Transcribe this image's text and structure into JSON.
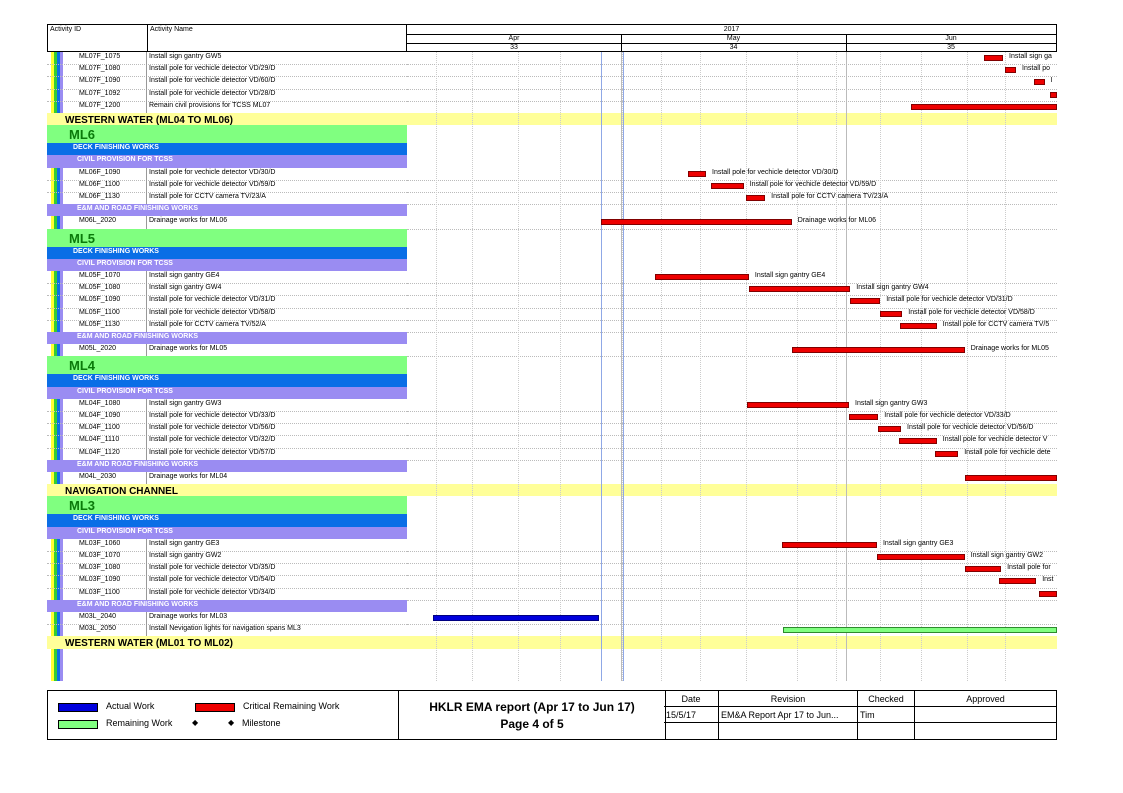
{
  "header": {
    "col_activity_id": "Activity ID",
    "col_activity_name": "Activity Name",
    "year": "2017",
    "months": [
      "Apr",
      "May",
      "Jun"
    ],
    "weeks": [
      "33",
      "34",
      "35"
    ]
  },
  "rows": [
    {
      "kind": "act",
      "id": "ML07F_1075",
      "name": "Install sign gantry GW5",
      "bar": {
        "type": "crit",
        "start": 0.887,
        "end": 0.917
      },
      "label": "Install sign ga"
    },
    {
      "kind": "act",
      "id": "ML07F_1080",
      "name": "Install pole for vechicle detector VD/29/D",
      "bar": {
        "type": "crit",
        "start": 0.92,
        "end": 0.937
      },
      "label": "Install po"
    },
    {
      "kind": "act",
      "id": "ML07F_1090",
      "name": "Install pole for vechicle detector VD/60/D",
      "bar": {
        "type": "crit",
        "start": 0.964,
        "end": 0.981
      },
      "label": "I"
    },
    {
      "kind": "act",
      "id": "ML07F_1092",
      "name": "Install pole for vechicle detector VD/28/D",
      "bar": {
        "type": "crit",
        "start": 0.989,
        "end": 1.0
      },
      "label": ""
    },
    {
      "kind": "act",
      "id": "ML07F_1200",
      "name": "Remain civil provisions for TCSS ML07",
      "bar": {
        "type": "crit",
        "start": 0.776,
        "end": 1.0
      },
      "label": ""
    },
    {
      "kind": "band-y",
      "label": "WESTERN WATER (ML04 TO ML06)"
    },
    {
      "kind": "band-g",
      "label": "ML6"
    },
    {
      "kind": "band-b",
      "label": "DECK FINISHING WORKS"
    },
    {
      "kind": "band-p",
      "label": "CIVIL PROVISION FOR TCSS"
    },
    {
      "kind": "act",
      "id": "ML06F_1090",
      "name": "Install pole for vechicle detector VD/30/D",
      "bar": {
        "type": "crit",
        "start": 0.433,
        "end": 0.46
      },
      "label": "Install pole for vechicle detector VD/30/D"
    },
    {
      "kind": "act",
      "id": "ML06F_1100",
      "name": "Install pole for vechicle detector VD/59/D",
      "bar": {
        "type": "crit",
        "start": 0.467,
        "end": 0.518
      },
      "label": "Install pole for vechicle detector VD/59/D"
    },
    {
      "kind": "act",
      "id": "ML06F_1130",
      "name": "Install pole for CCTV camera TV/23/A",
      "bar": {
        "type": "crit",
        "start": 0.522,
        "end": 0.551
      },
      "label": "Install pole for CCTV camera TV/23/A"
    },
    {
      "kind": "band-p",
      "label": "E&M AND ROAD FINISHING WORKS"
    },
    {
      "kind": "act",
      "id": "M06L_2020",
      "name": "Drainage works for ML06",
      "bar": {
        "type": "crit",
        "start": 0.298,
        "end": 0.592
      },
      "label": "Drainage works for ML06"
    },
    {
      "kind": "band-g",
      "label": "ML5"
    },
    {
      "kind": "band-b",
      "label": "DECK FINISHING WORKS"
    },
    {
      "kind": "band-p",
      "label": "CIVIL PROVISION FOR TCSS"
    },
    {
      "kind": "act",
      "id": "ML05F_1070",
      "name": "Install sign gantry GE4",
      "bar": {
        "type": "crit",
        "start": 0.381,
        "end": 0.526
      },
      "label": "Install sign gantry GE4"
    },
    {
      "kind": "act",
      "id": "ML05F_1080",
      "name": "Install sign gantry GW4",
      "bar": {
        "type": "crit",
        "start": 0.526,
        "end": 0.682
      },
      "label": "Install sign gantry GW4"
    },
    {
      "kind": "act",
      "id": "ML05F_1090",
      "name": "Install pole for vechicle detector VD/31/D",
      "bar": {
        "type": "crit",
        "start": 0.682,
        "end": 0.728
      },
      "label": "Install pole for vechicle detector VD/31/D"
    },
    {
      "kind": "act",
      "id": "ML05F_1100",
      "name": "Install pole for vechicle detector VD/58/D",
      "bar": {
        "type": "crit",
        "start": 0.728,
        "end": 0.762
      },
      "label": "Install pole for vechicle detector VD/58/D"
    },
    {
      "kind": "act",
      "id": "ML05F_1130",
      "name": "Install pole for CCTV camera TV/52/A",
      "bar": {
        "type": "crit",
        "start": 0.758,
        "end": 0.815
      },
      "label": "Install pole for CCTV camera TV/5"
    },
    {
      "kind": "band-p",
      "label": "E&M AND ROAD FINISHING WORKS"
    },
    {
      "kind": "act",
      "id": "M05L_2020",
      "name": "Drainage works for ML05",
      "bar": {
        "type": "crit",
        "start": 0.592,
        "end": 0.858
      },
      "label": "Drainage works for ML05"
    },
    {
      "kind": "band-g",
      "label": "ML4"
    },
    {
      "kind": "band-b",
      "label": "DECK FINISHING WORKS"
    },
    {
      "kind": "band-p",
      "label": "CIVIL PROVISION FOR TCSS"
    },
    {
      "kind": "act",
      "id": "ML04F_1080",
      "name": "Install sign gantry GW3",
      "bar": {
        "type": "crit",
        "start": 0.523,
        "end": 0.68
      },
      "label": "Install sign gantry GW3"
    },
    {
      "kind": "act",
      "id": "ML04F_1090",
      "name": "Install pole for vechicle detector VD/33/D",
      "bar": {
        "type": "crit",
        "start": 0.68,
        "end": 0.725
      },
      "label": "Install pole for vechicle detector VD/33/D"
    },
    {
      "kind": "act",
      "id": "ML04F_1100",
      "name": "Install pole for vechicle detector VD/56/D",
      "bar": {
        "type": "crit",
        "start": 0.725,
        "end": 0.76
      },
      "label": "Install pole for vechicle detector VD/56/D"
    },
    {
      "kind": "act",
      "id": "ML04F_1110",
      "name": "Install pole for vechicle detector VD/32/D",
      "bar": {
        "type": "crit",
        "start": 0.757,
        "end": 0.815
      },
      "label": "Install pole for vechicle detector V"
    },
    {
      "kind": "act",
      "id": "ML04F_1120",
      "name": "Install pole for vechicle detector VD/57/D",
      "bar": {
        "type": "crit",
        "start": 0.812,
        "end": 0.848
      },
      "label": "Install pole for vechicle dete"
    },
    {
      "kind": "band-p",
      "label": "E&M AND ROAD FINISHING WORKS"
    },
    {
      "kind": "act",
      "id": "M04L_2030",
      "name": "Drainage works for ML04",
      "bar": {
        "type": "crit",
        "start": 0.858,
        "end": 1.0
      },
      "label": ""
    },
    {
      "kind": "band-y",
      "label": "NAVIGATION CHANNEL"
    },
    {
      "kind": "band-g",
      "label": "ML3"
    },
    {
      "kind": "band-b",
      "label": "DECK FINISHING WORKS"
    },
    {
      "kind": "band-p",
      "label": "CIVIL PROVISION FOR TCSS"
    },
    {
      "kind": "act",
      "id": "ML03F_1060",
      "name": "Install sign gantry GE3",
      "bar": {
        "type": "crit",
        "start": 0.577,
        "end": 0.723
      },
      "label": "Install sign gantry GE3"
    },
    {
      "kind": "act",
      "id": "ML03F_1070",
      "name": "Install sign gantry GW2",
      "bar": {
        "type": "crit",
        "start": 0.723,
        "end": 0.858
      },
      "label": "Install sign gantry GW2"
    },
    {
      "kind": "act",
      "id": "ML03F_1080",
      "name": "Install pole for vechicle detector VD/35/D",
      "bar": {
        "type": "crit",
        "start": 0.858,
        "end": 0.914
      },
      "label": "Install pole for"
    },
    {
      "kind": "act",
      "id": "ML03F_1090",
      "name": "Install pole for vechicle detector VD/54/D",
      "bar": {
        "type": "crit",
        "start": 0.91,
        "end": 0.968
      },
      "label": "Inst"
    },
    {
      "kind": "act",
      "id": "ML03F_1100",
      "name": "Install pole for vechicle detector VD/34/D",
      "bar": {
        "type": "crit",
        "start": 0.973,
        "end": 1.0
      },
      "label": ""
    },
    {
      "kind": "band-p",
      "label": "E&M AND ROAD FINISHING WORKS"
    },
    {
      "kind": "act",
      "id": "M03L_2040",
      "name": "Drainage works for ML03",
      "bar": {
        "type": "actual",
        "start": 0.04,
        "end": 0.296
      },
      "label": ""
    },
    {
      "kind": "act",
      "id": "M03L_2050",
      "name": "Install Nevigation lights for navigation spans ML3",
      "bar": {
        "type": "remain",
        "start": 0.578,
        "end": 1.0
      },
      "label": ""
    },
    {
      "kind": "band-y",
      "label": "WESTERN WATER (ML01 TO ML02)"
    }
  ],
  "legend": {
    "actual": "Actual Work",
    "critical": "Critical Remaining Work",
    "remaining": "Remaining Work",
    "milestone": "Milestone"
  },
  "report": {
    "title": "HKLR EMA report (Apr 17 to Jun 17)",
    "page": "Page 4 of 5"
  },
  "revision_table": {
    "headers": [
      "Date",
      "Revision",
      "Checked",
      "Approved"
    ],
    "row": [
      "15/5/17",
      "EM&A Report Apr 17 to Jun...",
      "Tim",
      ""
    ]
  },
  "colors": {
    "critical": "#ee0000",
    "actual": "#0000dd",
    "remaining": "#80ff80",
    "band_yellow": "#ffff99",
    "band_green": "#80ff80",
    "band_blue": "#0a6ee6",
    "band_purple": "#9a8cf2"
  }
}
